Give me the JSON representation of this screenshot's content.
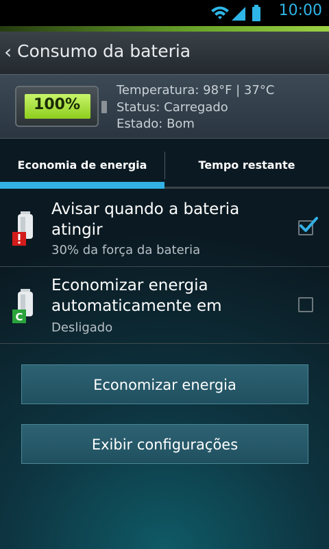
{
  "status_bar": {
    "time": "10:00",
    "icons": [
      "wifi-icon",
      "signal-icon",
      "battery-icon"
    ]
  },
  "title_bar": {
    "title": "Consumo da bateria"
  },
  "battery": {
    "percent_text": "100%",
    "level": 1.0,
    "temperature": "Temperatura: 98°F | 37°C",
    "status": "Status: Carregado",
    "health": "Estado: Bom"
  },
  "tabs": [
    {
      "label": "Economia de energia",
      "selected": true
    },
    {
      "label": "Tempo restante",
      "selected": false
    }
  ],
  "settings": [
    {
      "title": "Avisar quando a bateria atingir",
      "subtitle": "30% da força da bateria",
      "checked": true,
      "badge": "!",
      "badge_color": "#d31b1b"
    },
    {
      "title": "Economizar energia automaticamente em",
      "subtitle": "Desligado",
      "checked": false,
      "badge": "C",
      "badge_color": "#2aa33a"
    }
  ],
  "buttons": {
    "save_energy": "Economizar energia",
    "show_settings": "Exibir configurações"
  },
  "colors": {
    "accent": "#33b1e5",
    "battery_fill": "#a6e23a",
    "titlebar": "#2e353a"
  }
}
